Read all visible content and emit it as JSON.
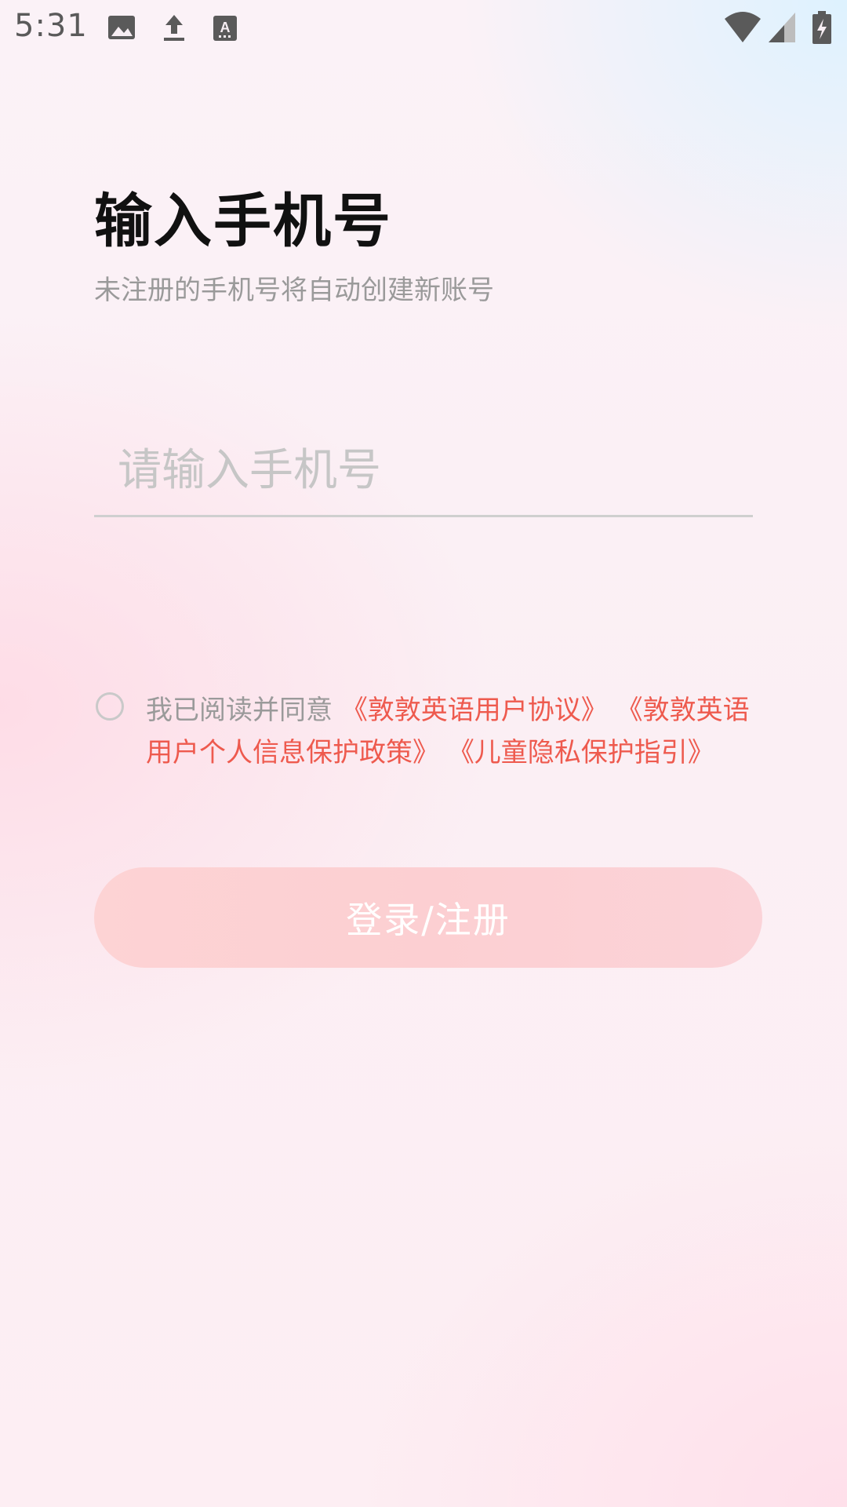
{
  "status_bar": {
    "time": "5:31",
    "left_icons": [
      "image-icon",
      "upload-icon",
      "font-download-icon"
    ],
    "right_icons": [
      "wifi-icon",
      "cellular-signal-icon",
      "battery-charging-icon"
    ]
  },
  "header": {
    "title": "输入手机号",
    "subtitle": "未注册的手机号将自动创建新账号"
  },
  "phone_input": {
    "value": "",
    "placeholder": "请输入手机号"
  },
  "agreement": {
    "checked": false,
    "prefix": "我已阅读并同意",
    "user_agreement": "《敦敦英语用户协议》",
    "privacy_policy": "《敦敦英语用户个人信息保护政策》",
    "child_privacy": "《儿童隐私保护指引》"
  },
  "login_button": {
    "label": "登录/注册"
  },
  "colors": {
    "link": "#ee5a4e",
    "button": "#fcd0d3",
    "muted_text": "#9a9a9a"
  }
}
